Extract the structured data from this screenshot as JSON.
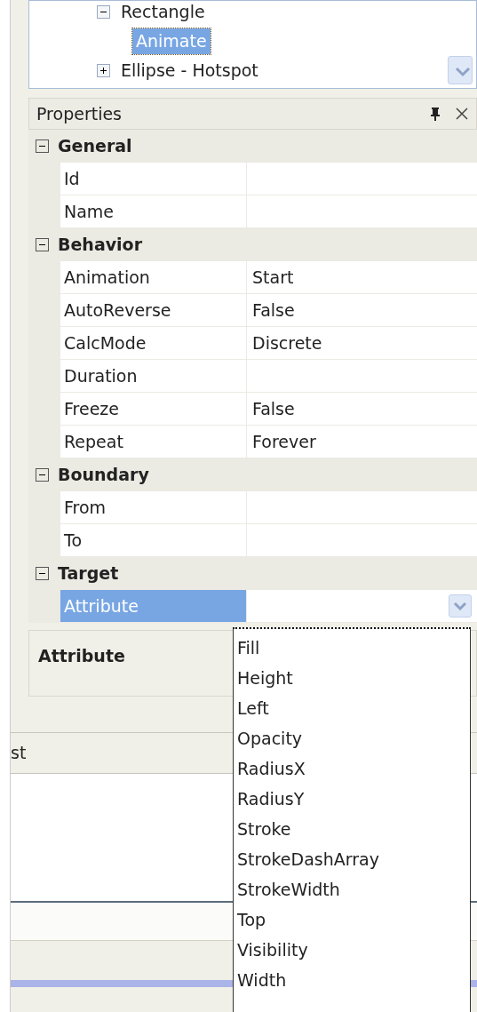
{
  "tree": {
    "items": [
      {
        "label": "Rectangle",
        "expanded": true,
        "children": [
          {
            "label": "Animate",
            "selected": true
          }
        ]
      },
      {
        "label": "Ellipse - Hotspot",
        "expanded": false
      }
    ]
  },
  "properties": {
    "title": "Properties",
    "groups": [
      {
        "name": "General",
        "expanded": true,
        "rows": [
          {
            "name": "Id",
            "selected": false
          },
          {
            "name": "Name",
            "selected": false
          }
        ]
      },
      {
        "name": "Behavior",
        "expanded": true,
        "rows": [
          {
            "name": "Animation",
            "value": "Start",
            "selected": false
          },
          {
            "name": "AutoReverse",
            "value": "False",
            "selected": false
          },
          {
            "name": "CalcMode",
            "value": "Discrete",
            "selected": false
          },
          {
            "name": "Duration",
            "selected": false
          },
          {
            "name": "Freeze",
            "value": "False",
            "selected": false
          },
          {
            "name": "Repeat",
            "value": "Forever",
            "selected": false
          }
        ]
      },
      {
        "name": "Boundary",
        "expanded": true,
        "rows": [
          {
            "name": "From",
            "selected": false
          },
          {
            "name": "To",
            "selected": false
          }
        ]
      },
      {
        "name": "Target",
        "expanded": true,
        "rows": [
          {
            "name": "Attribute",
            "selected": true,
            "dropdown": true
          }
        ]
      }
    ]
  },
  "description": {
    "title": "Attribute"
  },
  "bottom_tab": {
    "label": "st"
  },
  "dropdown": {
    "items": [
      "Fill",
      "Height",
      "Left",
      "Opacity",
      "RadiusX",
      "RadiusY",
      "Stroke",
      "StrokeDashArray",
      "StrokeWidth",
      "Top",
      "Visibility",
      "Width"
    ]
  }
}
